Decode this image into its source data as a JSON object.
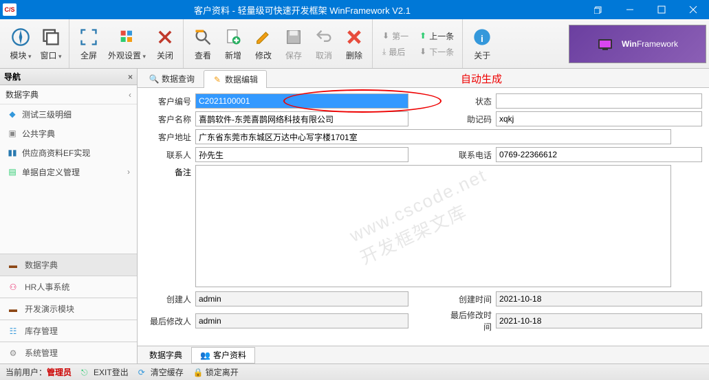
{
  "titlebar": {
    "app_icon": "C/S",
    "title": "客户资料 - 轻量级可快速开发框架 WinFramework V2.1"
  },
  "ribbon": {
    "module": "模块",
    "window": "窗口",
    "fullscreen": "全屏",
    "appearance": "外观设置",
    "close": "关闭",
    "view": "查看",
    "add": "新增",
    "edit": "修改",
    "save": "保存",
    "cancel": "取消",
    "delete": "删除",
    "first": "第一",
    "prev": "上一条",
    "last": "最后",
    "next": "下一条",
    "about": "关于",
    "banner_prefix": "Win",
    "banner_suffix": "Framework"
  },
  "sidebar": {
    "title": "导航",
    "section": "数据字典",
    "items": [
      {
        "label": "测试三级明细"
      },
      {
        "label": "公共字典"
      },
      {
        "label": "供应商资料EF实现"
      },
      {
        "label": "单据自定义管理"
      }
    ],
    "accordions": [
      {
        "label": "数据字典"
      },
      {
        "label": "HR人事系统"
      },
      {
        "label": "开发演示模块"
      },
      {
        "label": "库存管理"
      },
      {
        "label": "系统管理"
      }
    ]
  },
  "tabs": {
    "query": "数据查询",
    "edit": "数据编辑",
    "auto_gen": "自动生成"
  },
  "form": {
    "labels": {
      "cust_no": "客户编号",
      "status": "状态",
      "cust_name": "客户名称",
      "mnemonic": "助记码",
      "address": "客户地址",
      "contact": "联系人",
      "phone": "联系电话",
      "remark": "备注",
      "creator": "创建人",
      "create_time": "创建时间",
      "modifier": "最后修改人",
      "modify_time": "最后修改时间"
    },
    "values": {
      "cust_no": "C2021100001",
      "status": "",
      "cust_name": "喜鹊软件-东莞喜鹊网络科技有限公司",
      "mnemonic": "xqkj",
      "address": "广东省东莞市东城区万达中心写字楼1701室",
      "contact": "孙先生",
      "phone": "0769-22366612",
      "remark": "",
      "creator": "admin",
      "create_time": "2021-10-18",
      "modifier": "admin",
      "modify_time": "2021-10-18"
    }
  },
  "watermark": "www.cscode.net\n开发框架文库",
  "bottom_tabs": {
    "dict": "数据字典",
    "cust": "客户资料"
  },
  "statusbar": {
    "user_label": "当前用户：",
    "user_name": "管理员",
    "exit": "EXIT登出",
    "clear_cache": "清空缓存",
    "lock": "锁定离开"
  }
}
